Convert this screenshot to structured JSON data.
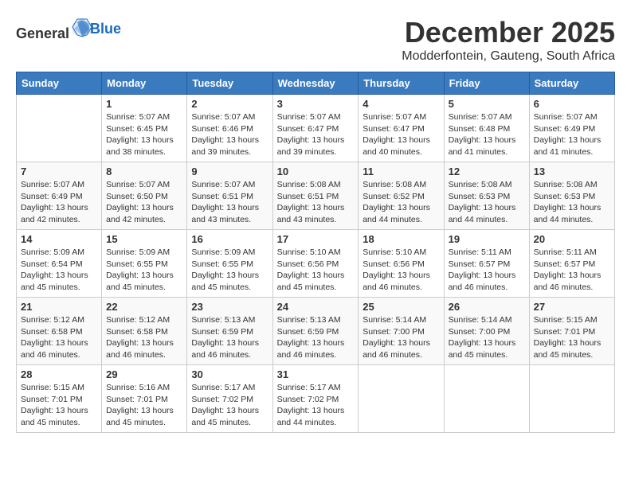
{
  "header": {
    "logo_general": "General",
    "logo_blue": "Blue",
    "month": "December 2025",
    "location": "Modderfontein, Gauteng, South Africa"
  },
  "days_of_week": [
    "Sunday",
    "Monday",
    "Tuesday",
    "Wednesday",
    "Thursday",
    "Friday",
    "Saturday"
  ],
  "weeks": [
    [
      {
        "day": "",
        "info": ""
      },
      {
        "day": "1",
        "info": "Sunrise: 5:07 AM\nSunset: 6:45 PM\nDaylight: 13 hours\nand 38 minutes."
      },
      {
        "day": "2",
        "info": "Sunrise: 5:07 AM\nSunset: 6:46 PM\nDaylight: 13 hours\nand 39 minutes."
      },
      {
        "day": "3",
        "info": "Sunrise: 5:07 AM\nSunset: 6:47 PM\nDaylight: 13 hours\nand 39 minutes."
      },
      {
        "day": "4",
        "info": "Sunrise: 5:07 AM\nSunset: 6:47 PM\nDaylight: 13 hours\nand 40 minutes."
      },
      {
        "day": "5",
        "info": "Sunrise: 5:07 AM\nSunset: 6:48 PM\nDaylight: 13 hours\nand 41 minutes."
      },
      {
        "day": "6",
        "info": "Sunrise: 5:07 AM\nSunset: 6:49 PM\nDaylight: 13 hours\nand 41 minutes."
      }
    ],
    [
      {
        "day": "7",
        "info": "Sunrise: 5:07 AM\nSunset: 6:49 PM\nDaylight: 13 hours\nand 42 minutes."
      },
      {
        "day": "8",
        "info": "Sunrise: 5:07 AM\nSunset: 6:50 PM\nDaylight: 13 hours\nand 42 minutes."
      },
      {
        "day": "9",
        "info": "Sunrise: 5:07 AM\nSunset: 6:51 PM\nDaylight: 13 hours\nand 43 minutes."
      },
      {
        "day": "10",
        "info": "Sunrise: 5:08 AM\nSunset: 6:51 PM\nDaylight: 13 hours\nand 43 minutes."
      },
      {
        "day": "11",
        "info": "Sunrise: 5:08 AM\nSunset: 6:52 PM\nDaylight: 13 hours\nand 44 minutes."
      },
      {
        "day": "12",
        "info": "Sunrise: 5:08 AM\nSunset: 6:53 PM\nDaylight: 13 hours\nand 44 minutes."
      },
      {
        "day": "13",
        "info": "Sunrise: 5:08 AM\nSunset: 6:53 PM\nDaylight: 13 hours\nand 44 minutes."
      }
    ],
    [
      {
        "day": "14",
        "info": "Sunrise: 5:09 AM\nSunset: 6:54 PM\nDaylight: 13 hours\nand 45 minutes."
      },
      {
        "day": "15",
        "info": "Sunrise: 5:09 AM\nSunset: 6:55 PM\nDaylight: 13 hours\nand 45 minutes."
      },
      {
        "day": "16",
        "info": "Sunrise: 5:09 AM\nSunset: 6:55 PM\nDaylight: 13 hours\nand 45 minutes."
      },
      {
        "day": "17",
        "info": "Sunrise: 5:10 AM\nSunset: 6:56 PM\nDaylight: 13 hours\nand 45 minutes."
      },
      {
        "day": "18",
        "info": "Sunrise: 5:10 AM\nSunset: 6:56 PM\nDaylight: 13 hours\nand 46 minutes."
      },
      {
        "day": "19",
        "info": "Sunrise: 5:11 AM\nSunset: 6:57 PM\nDaylight: 13 hours\nand 46 minutes."
      },
      {
        "day": "20",
        "info": "Sunrise: 5:11 AM\nSunset: 6:57 PM\nDaylight: 13 hours\nand 46 minutes."
      }
    ],
    [
      {
        "day": "21",
        "info": "Sunrise: 5:12 AM\nSunset: 6:58 PM\nDaylight: 13 hours\nand 46 minutes."
      },
      {
        "day": "22",
        "info": "Sunrise: 5:12 AM\nSunset: 6:58 PM\nDaylight: 13 hours\nand 46 minutes."
      },
      {
        "day": "23",
        "info": "Sunrise: 5:13 AM\nSunset: 6:59 PM\nDaylight: 13 hours\nand 46 minutes."
      },
      {
        "day": "24",
        "info": "Sunrise: 5:13 AM\nSunset: 6:59 PM\nDaylight: 13 hours\nand 46 minutes."
      },
      {
        "day": "25",
        "info": "Sunrise: 5:14 AM\nSunset: 7:00 PM\nDaylight: 13 hours\nand 46 minutes."
      },
      {
        "day": "26",
        "info": "Sunrise: 5:14 AM\nSunset: 7:00 PM\nDaylight: 13 hours\nand 45 minutes."
      },
      {
        "day": "27",
        "info": "Sunrise: 5:15 AM\nSunset: 7:01 PM\nDaylight: 13 hours\nand 45 minutes."
      }
    ],
    [
      {
        "day": "28",
        "info": "Sunrise: 5:15 AM\nSunset: 7:01 PM\nDaylight: 13 hours\nand 45 minutes."
      },
      {
        "day": "29",
        "info": "Sunrise: 5:16 AM\nSunset: 7:01 PM\nDaylight: 13 hours\nand 45 minutes."
      },
      {
        "day": "30",
        "info": "Sunrise: 5:17 AM\nSunset: 7:02 PM\nDaylight: 13 hours\nand 45 minutes."
      },
      {
        "day": "31",
        "info": "Sunrise: 5:17 AM\nSunset: 7:02 PM\nDaylight: 13 hours\nand 44 minutes."
      },
      {
        "day": "",
        "info": ""
      },
      {
        "day": "",
        "info": ""
      },
      {
        "day": "",
        "info": ""
      }
    ]
  ]
}
